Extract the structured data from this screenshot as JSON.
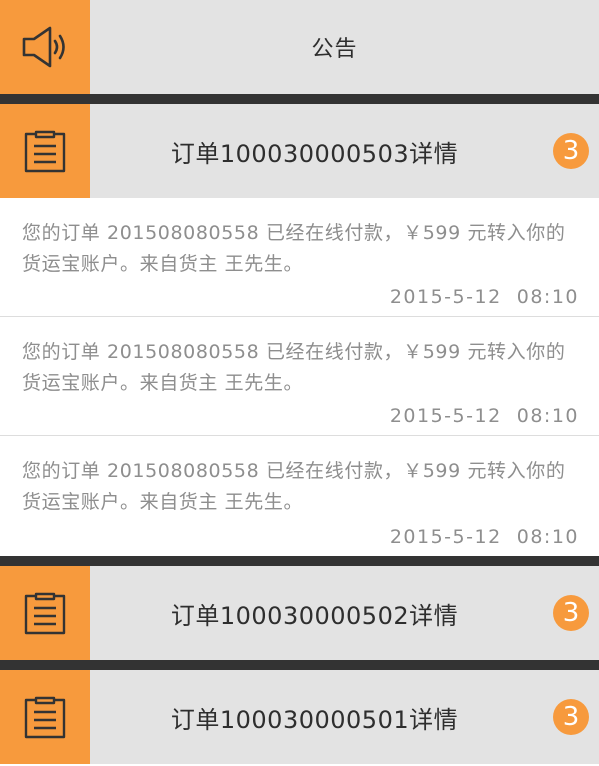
{
  "notice": {
    "title": "公告"
  },
  "orders": [
    {
      "title": "订单100030000503详情",
      "badge": "3"
    },
    {
      "title": "订单100030000502详情",
      "badge": "3"
    },
    {
      "title": "订单100030000501详情",
      "badge": "3"
    }
  ],
  "messages": [
    {
      "text": "您的订单 201508080558 已经在线付款，￥599 元转入你的货运宝账户。来自货主 王先生。",
      "time": "2015-5-12  08:10"
    },
    {
      "text": "您的订单 201508080558 已经在线付款，￥599 元转入你的货运宝账户。来自货主 王先生。",
      "time": "2015-5-12  08:10"
    },
    {
      "text": "您的订单 201508080558 已经在线付款，￥599 元转入你的货运宝账户。来自货主 王先生。",
      "time": "2015-5-12  08:10"
    }
  ],
  "icons": {
    "notice": "speaker-icon",
    "order": "clipboard-icon"
  },
  "colors": {
    "accent": "#f79a3d",
    "header_bg": "#e3e3e3",
    "separator": "#333333",
    "muted_text": "#8e8e8e"
  }
}
